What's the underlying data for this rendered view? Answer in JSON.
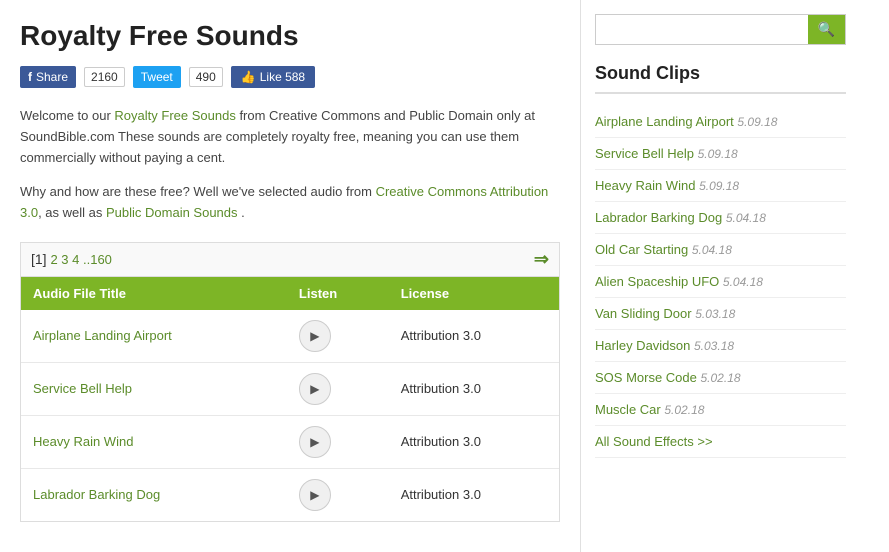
{
  "page": {
    "title": "Royalty Free Sounds"
  },
  "social": {
    "fb_label": "Share",
    "fb_count": "2160",
    "tw_label": "Tweet",
    "tw_count": "490",
    "like_label": "Like 588"
  },
  "intro": {
    "text1": "Welcome to our ",
    "link1": "Royalty Free Sounds",
    "text2": " from Creative Commons and Public Domain only at SoundBible.com These sounds are completely royalty free, meaning you can use them commercially without paying a cent.",
    "text3": "Why and how are these free? Well we've selected audio from ",
    "link2": "Creative Commons Attribution 3.0",
    "text4": ", as well as ",
    "link3": "Public Domain Sounds",
    "text5": " ."
  },
  "table": {
    "nav_current": "[1]",
    "nav_pages": "2 3 4 ..160",
    "columns": [
      "Audio File Title",
      "Listen",
      "License"
    ],
    "rows": [
      {
        "title": "Airplane Landing Airport",
        "license": "Attribution 3.0"
      },
      {
        "title": "Service Bell Help",
        "license": "Attribution 3.0"
      },
      {
        "title": "Heavy Rain Wind",
        "license": "Attribution 3.0"
      },
      {
        "title": "Labrador Barking Dog",
        "license": "Attribution 3.0"
      }
    ]
  },
  "sidebar": {
    "search_placeholder": "",
    "search_icon": "🔍",
    "title": "Sound Clips",
    "items": [
      {
        "name": "Airplane Landing Airport",
        "date": "5.09.18"
      },
      {
        "name": "Service Bell Help",
        "date": "5.09.18"
      },
      {
        "name": "Heavy Rain Wind",
        "date": "5.09.18"
      },
      {
        "name": "Labrador Barking Dog",
        "date": "5.04.18"
      },
      {
        "name": "Old Car Starting",
        "date": "5.04.18"
      },
      {
        "name": "Alien Spaceship UFO",
        "date": "5.04.18"
      },
      {
        "name": "Van Sliding Door",
        "date": "5.03.18"
      },
      {
        "name": "Harley Davidson",
        "date": "5.03.18"
      },
      {
        "name": "SOS Morse Code",
        "date": "5.02.18"
      },
      {
        "name": "Muscle Car",
        "date": "5.02.18"
      }
    ],
    "all_label": "All Sound Effects >>",
    "service_bell_sidebar": "Service Bell Help 5.09_18"
  }
}
